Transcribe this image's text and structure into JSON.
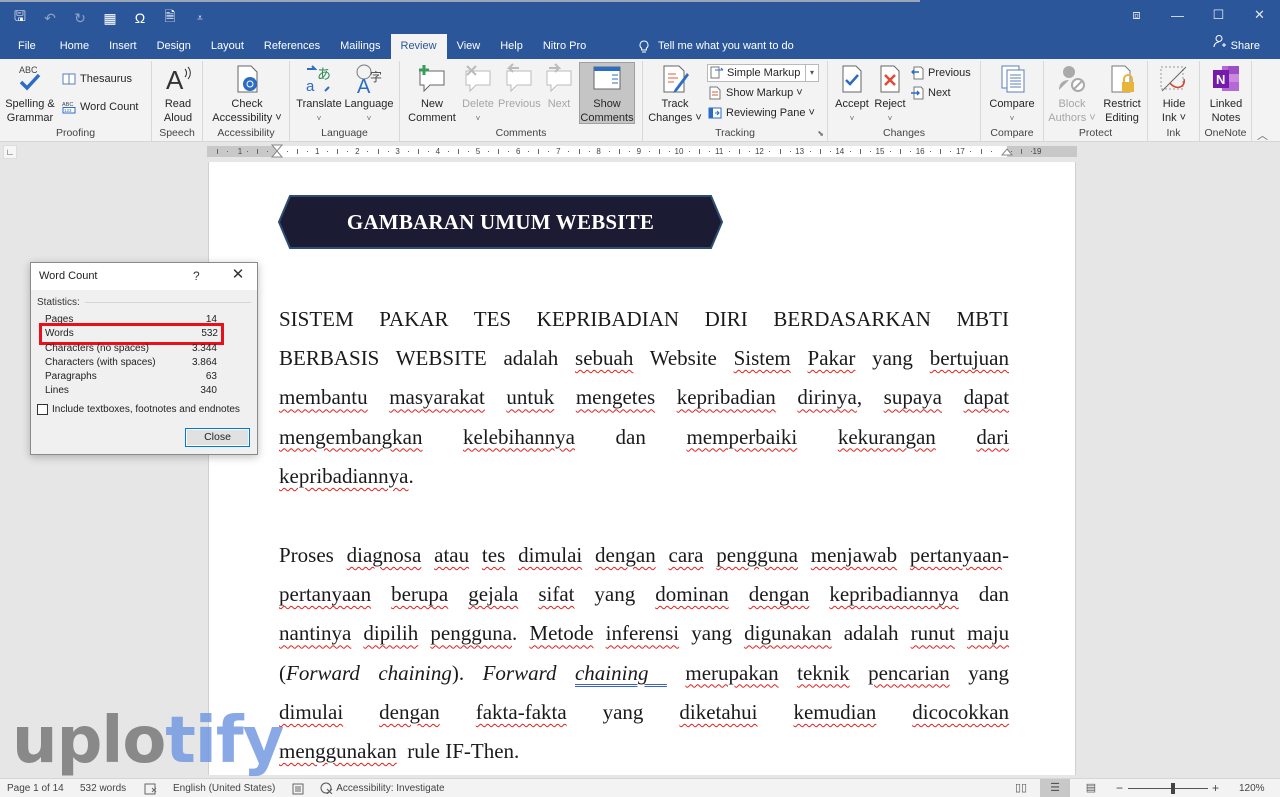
{
  "titlebar": {
    "qat": [
      {
        "name": "save-icon",
        "glyph": "🖫"
      },
      {
        "name": "undo-icon",
        "glyph": "↶"
      },
      {
        "name": "redo-icon",
        "glyph": "↻"
      },
      {
        "name": "table-icon",
        "glyph": "▦"
      },
      {
        "name": "omega-symbol-icon",
        "glyph": "Ω"
      },
      {
        "name": "document-icon",
        "glyph": "🗎"
      },
      {
        "name": "customize-qat-icon",
        "glyph": "⩡"
      }
    ],
    "window_controls": {
      "ribbon_display": "⧈",
      "minimize": "—",
      "maximize": "☐",
      "close": "✕"
    }
  },
  "tabs": [
    "File",
    "Home",
    "Insert",
    "Design",
    "Layout",
    "References",
    "Mailings",
    "Review",
    "View",
    "Help",
    "Nitro Pro"
  ],
  "active_tab": "Review",
  "tell_me": {
    "icon": "lightbulb-icon",
    "text": "Tell me what you want to do"
  },
  "share": {
    "icon": "person-icon",
    "label": "Share"
  },
  "ribbon": {
    "groups": {
      "proofing": "Proofing",
      "speech": "Speech",
      "accessibility": "Accessibility",
      "language": "Language",
      "comments": "Comments",
      "tracking": "Tracking",
      "changes": "Changes",
      "compare": "Compare",
      "protect": "Protect",
      "ink": "Ink",
      "onenote": "OneNote"
    },
    "buttons": {
      "spelling": [
        "Spelling &",
        "Grammar"
      ],
      "thesaurus": "Thesaurus",
      "word_count": "Word Count",
      "read_aloud": [
        "Read",
        "Aloud"
      ],
      "check_accessibility": [
        "Check",
        "Accessibility ˅"
      ],
      "translate": [
        "Translate",
        "˅"
      ],
      "language": [
        "Language",
        "˅"
      ],
      "new_comment": [
        "New",
        "Comment"
      ],
      "delete": [
        "Delete",
        "˅"
      ],
      "previous_comment": [
        "Previous",
        ""
      ],
      "next_comment": [
        "Next",
        ""
      ],
      "show_comments": [
        "Show",
        "Comments"
      ],
      "track_changes": [
        "Track",
        "Changes ˅"
      ],
      "markup_select": "Simple Markup",
      "show_markup": "Show Markup ˅",
      "reviewing_pane": "Reviewing Pane  ˅",
      "accept": [
        "Accept",
        "˅"
      ],
      "reject": [
        "Reject",
        "˅"
      ],
      "previous_change": "Previous",
      "next_change": "Next",
      "compare": [
        "Compare",
        "˅"
      ],
      "block_authors": [
        "Block",
        "Authors ˅"
      ],
      "restrict_editing": [
        "Restrict",
        "Editing"
      ],
      "hide_ink": [
        "Hide",
        "Ink ˅"
      ],
      "linked_notes": [
        "Linked",
        "Notes"
      ]
    }
  },
  "ruler": {
    "left_numbers": [
      "1"
    ],
    "numbers": [
      "1",
      "2",
      "3",
      "4",
      "5",
      "6",
      "7",
      "8",
      "9",
      "10",
      "11",
      "12",
      "13",
      "14",
      "15",
      "16",
      "17"
    ],
    "right_numbers": [
      "19"
    ]
  },
  "document": {
    "heading": "GAMBARAN UMUM WEBSITE",
    "colors": {
      "banner_fill": "#1b1b33",
      "banner_border": "#2e4d70",
      "spell_error": "#e0201b",
      "grammar_error": "#3a63c9"
    }
  },
  "dialog": {
    "title": "Word Count",
    "help": "?",
    "close_icon": "✕",
    "statistics_label": "Statistics:",
    "stats": [
      {
        "label": "Pages",
        "value": "14"
      },
      {
        "label": "Words",
        "value": "532"
      },
      {
        "label": "Characters (no spaces)",
        "value": "3.344"
      },
      {
        "label": "Characters (with spaces)",
        "value": "3.864"
      },
      {
        "label": "Paragraphs",
        "value": "63"
      },
      {
        "label": "Lines",
        "value": "340"
      }
    ],
    "highlighted_stat": "Words",
    "include_checkbox": {
      "label": "Include textboxes, footnotes and endnotes",
      "checked": false
    },
    "close_button": "Close"
  },
  "watermark": {
    "part1": "uplo",
    "part2": "tify"
  },
  "statusbar": {
    "page": "Page 1 of 14",
    "words": "532 words",
    "proofing_icon": "book-check-icon",
    "language": "English (United States)",
    "accessibility": "Accessibility: Investigate",
    "zoom_minus": "−",
    "zoom_plus": "+",
    "zoom_level": "120%",
    "zoom_percent": 120
  }
}
